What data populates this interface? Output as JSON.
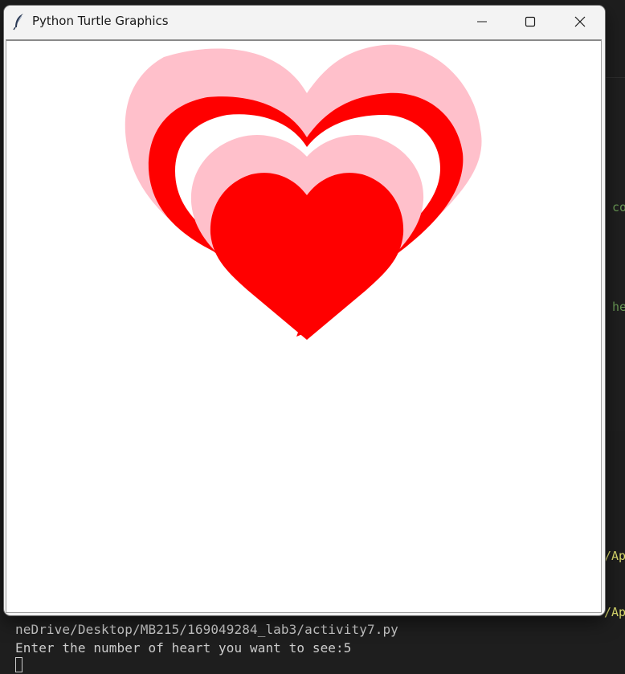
{
  "window": {
    "title": "Python Turtle Graphics",
    "controls": {
      "minimize": "minimize",
      "maximize": "maximize",
      "close": "close"
    }
  },
  "canvas": {
    "hearts": [
      {
        "color": "#ffc0cb"
      },
      {
        "color": "#ff0000"
      },
      {
        "color": "#ffffff"
      },
      {
        "color": "#ffc0cb"
      },
      {
        "color": "#ff0000"
      }
    ]
  },
  "terminal": {
    "path_line": "neDrive/Desktop/MB215/169049284_lab3/activity7.py",
    "prompt_line": "Enter the number of heart you want to see:5"
  },
  "background": {
    "snippet_co": "co",
    "snippet_he": "he",
    "snippet_ap1": "/Ap",
    "snippet_ap2": "/Ap"
  }
}
